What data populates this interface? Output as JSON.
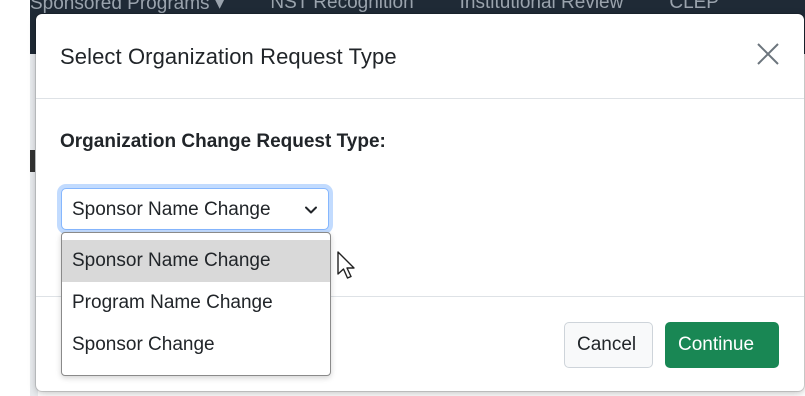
{
  "background": {
    "nav_items": [
      "Sponsored Programs ▾",
      "NST Recognition",
      "Institutional Review",
      "CLEP"
    ]
  },
  "modal": {
    "title": "Select Organization Request Type",
    "close_icon": "close-icon",
    "field_label": "Organization Change Request Type:",
    "select": {
      "value": "Sponsor Name Change",
      "options": [
        "Sponsor Name Change",
        "Program Name Change",
        "Sponsor Change"
      ],
      "selected_index": 0
    },
    "footer": {
      "cancel_label": "Cancel",
      "continue_label": "Continue"
    }
  },
  "colors": {
    "continue_button": "#198754",
    "focus_ring": "#86b7fe",
    "nav_background": "#1f2a36",
    "option_highlight": "#d9d9d9"
  }
}
